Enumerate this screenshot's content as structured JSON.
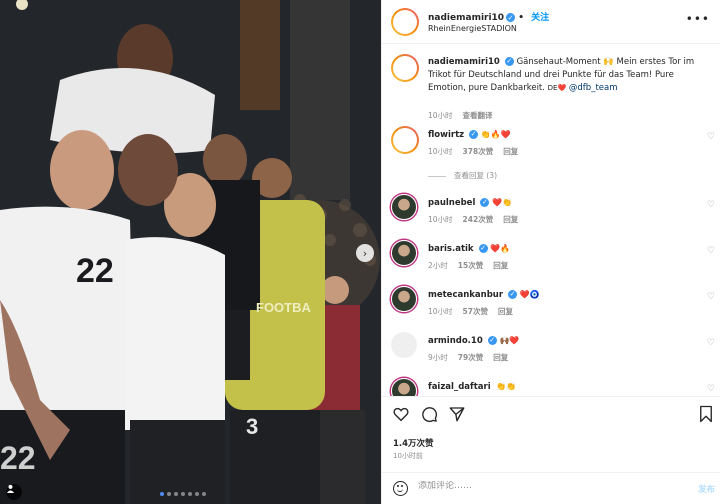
{
  "post": {
    "username": "nadiemamiri10",
    "follow_label": "关注",
    "location": "RheinEnergieSTADION",
    "caption_prefix": "Gänsehaut-Moment 🙌 Mein erstes Tor im Trikot für Deutschland und drei Punkte für das Team! Pure Emotion, pure Dankbarkeit. ",
    "caption_flag": "DE❤️",
    "caption_mention": "@dfb_team",
    "caption_time": "10小时",
    "caption_translate": "查看翻译",
    "likes": "1.4万次赞",
    "posted_ago": "10小时前"
  },
  "photo": {
    "jersey_left": "22",
    "jersey_right_bottom": "3",
    "jersey_corner": "22",
    "sponsor_text": "FOOTBA",
    "next_icon": "chevron-right-icon"
  },
  "comments": [
    {
      "user": "flowirtz",
      "text": "👏🔥❤️",
      "time": "10小时",
      "likes": "378次赞",
      "reply": "回复",
      "view_replies": "查看回复 (3)",
      "avatar": "ring"
    },
    {
      "user": "paulnebel",
      "text": "❤️👏",
      "time": "10小时",
      "likes": "242次赞",
      "reply": "回复",
      "avatar": "photo"
    },
    {
      "user": "baris.atik",
      "text": "❤️🔥",
      "time": "2小时",
      "likes": "15次赞",
      "reply": "回复",
      "avatar": "photo"
    },
    {
      "user": "metecankanbur",
      "text": "❤️🧿",
      "time": "10小时",
      "likes": "57次赞",
      "reply": "回复",
      "avatar": "photo"
    },
    {
      "user": "armindo.10",
      "text": "🙌🏾❤️",
      "time": "9小时",
      "likes": "79次赞",
      "reply": "回复",
      "avatar": "plain"
    },
    {
      "user": "faizal_daftari",
      "text": "👏👏",
      "avatar": "photo"
    }
  ],
  "composer": {
    "placeholder": "添加评论……",
    "post_label": "发布"
  },
  "colors": {
    "verified": "#3897f0",
    "follow": "#0095f6",
    "heart": "#ed4956"
  }
}
